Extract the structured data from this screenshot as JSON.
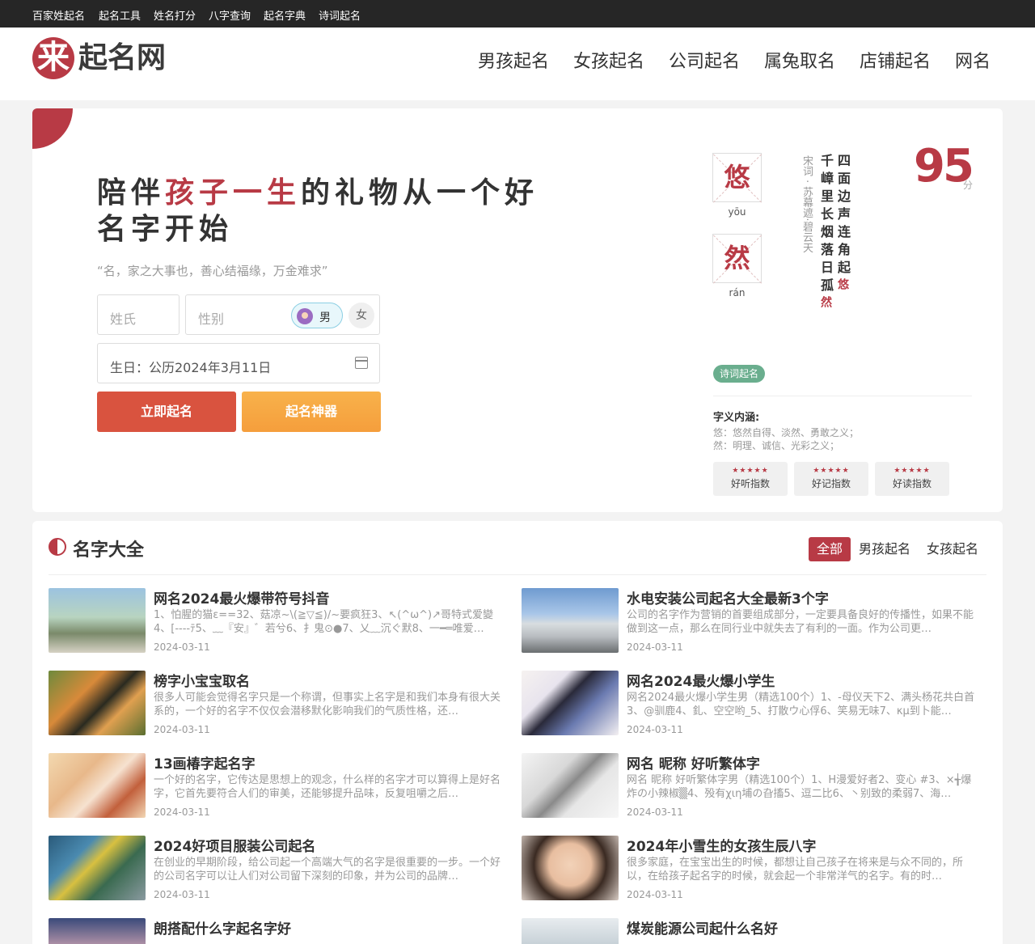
{
  "topbar": {
    "links": [
      "百家姓起名",
      "起名工具",
      "姓名打分",
      "八字查询",
      "起名字典",
      "诗词起名"
    ]
  },
  "header": {
    "logo_mark": "来",
    "logo_text": "起名网",
    "nav": [
      "男孩起名",
      "女孩起名",
      "公司起名",
      "属兔取名",
      "店铺起名",
      "网名"
    ]
  },
  "hero": {
    "title_pre": "陪伴",
    "title_hl": "孩子一生",
    "title_post": "的礼物从一个好名字开始",
    "quote": "“名，家之大事也，善心结福缘，万金难求”",
    "surname_placeholder": "姓氏",
    "gender_placeholder": "性别",
    "male": "男",
    "female": "女",
    "birthday": "生日：公历2024年3月11日",
    "btn_name": "立即起名",
    "btn_tool": "起名神器"
  },
  "sample": {
    "char1": "悠",
    "pinyin1": "yōu",
    "char2": "然",
    "pinyin2": "rán",
    "author": "宋词 · 苏幕遮·碧云天",
    "poem_col1": {
      "text": "四面边声连角起",
      "hl": "悠"
    },
    "poem_col2": {
      "text": "千嶂里长烟落日孤",
      "hl": "然"
    },
    "score": "95",
    "score_unit": "分",
    "tag": "诗词起名",
    "meaning_title": "字义内涵:",
    "meaning1": "悠：悠然自得、淡然、勇敢之义；",
    "meaning2": "然：明理、诚信、光彩之义；",
    "indexes": [
      {
        "stars": "★★★★★",
        "label": "好听指数"
      },
      {
        "stars": "★★★★★",
        "label": "好记指数"
      },
      {
        "stars": "★★★★★",
        "label": "好读指数"
      }
    ]
  },
  "section": {
    "title": "名字大全",
    "tabs": [
      "全部",
      "男孩起名",
      "女孩起名"
    ],
    "items": [
      {
        "title": "网名2024最火爆带符号抖音",
        "desc": "1、怕腥的猫ε==32、菇凉~\\(≧▽≦)/~要疯狂3、↖(^ω^)↗哥特式爱變4、[----ﾃ5、﹏『安』゛若兮6、扌鬼⊙●7、乂﹏沉ぐ默8、一━═唯爱…",
        "date": "2024-03-11"
      },
      {
        "title": "水电安装公司起名大全最新3个字",
        "desc": "公司的名字作为营销的首要组成部分，一定要具备良好的传播性，如果不能做到这一点，那么在同行业中就失去了有利的一面。作为公司更…",
        "date": "2024-03-11"
      },
      {
        "title": "榜字小宝宝取名",
        "desc": "很多人可能会觉得名字只是一个称谓，但事实上名字是和我们本身有很大关系的，一个好的名字不仅仅会潜移默化影响我们的气质性格，还…",
        "date": "2024-03-11"
      },
      {
        "title": "网名2024最火爆小学生",
        "desc": "网名2024最火爆小学生男（精选100个）1、-母仪天下2、满头杨花共白首3、@驯鹿4、釓、空空哟_5、打散ウ心俘6、笑易无味7、κμ到卜能…",
        "date": "2024-03-11"
      },
      {
        "title": "13画椿字起名字",
        "desc": "一个好的名字，它传达是思想上的观念，什么样的名字才可以算得上是好名字，它首先要符合人们的审美，还能够提升品味，反复咀嚼之后…",
        "date": "2024-03-11"
      },
      {
        "title": "网名 昵称 好听繁体字",
        "desc": "网名 昵称 好听繁体字男（精选100个）1、H漫爱好者2、变心 #3、×╅爆炸の小辣椒▒4、殁有χιη埔の旮搐5、逗二比6、丶别致的柔弱7、海…",
        "date": "2024-03-11"
      },
      {
        "title": "2024好项目服装公司起名",
        "desc": "在创业的早期阶段，给公司起一个高端大气的名字是很重要的一步。一个好的公司名字可以让人们对公司留下深刻的印象，并为公司的品牌…",
        "date": "2024-03-11"
      },
      {
        "title": "2024年小雪生的女孩生辰八字",
        "desc": "很多家庭，在宝宝出生的时候，都想让自己孩子在将来是与众不同的，所以，在给孩子起名字的时候，就会起一个非常洋气的名字。有的时…",
        "date": "2024-03-11"
      },
      {
        "title": "朗搭配什么字起名字好",
        "desc": "",
        "date": ""
      },
      {
        "title": "煤炭能源公司起什么名好",
        "desc": "",
        "date": ""
      }
    ]
  }
}
